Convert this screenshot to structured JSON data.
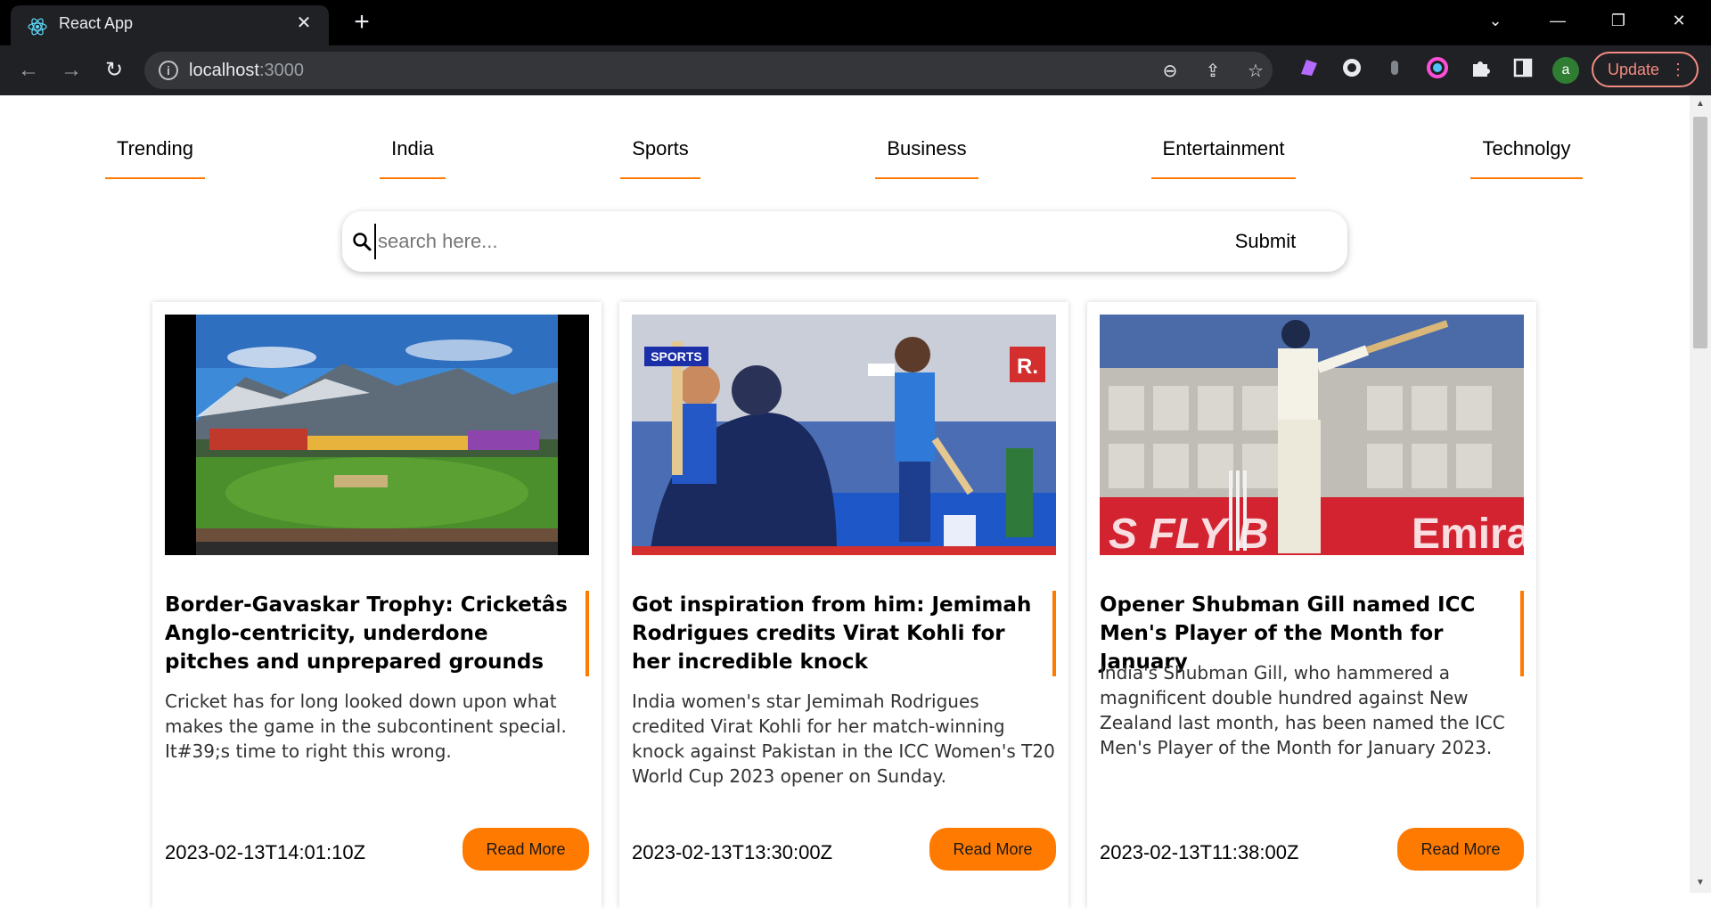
{
  "browser": {
    "tab_title": "React App",
    "url_host": "localhost",
    "url_port": ":3000",
    "profile_initial": "a",
    "update_label": "Update"
  },
  "nav": {
    "items": [
      "Trending",
      "India",
      "Sports",
      "Business",
      "Entertainment",
      "Technolgy"
    ]
  },
  "search": {
    "placeholder": "search here...",
    "submit_label": "Submit"
  },
  "cards": [
    {
      "title": "Border-Gavaskar Trophy: Cricketâs Anglo-centricity, underdone pitches and unprepared grounds",
      "description": "Cricket has for long looked down upon what makes the game in the subcontinent special. It#39;s time to right this wrong.",
      "date": "2023-02-13T14:01:10Z",
      "button": "Read More"
    },
    {
      "title": "Got inspiration from him: Jemimah Rodrigues credits Virat Kohli for her incredible knock",
      "description": "India women's star Jemimah Rodrigues credited Virat Kohli for her match-winning knock against Pakistan in the ICC Women's T20 World Cup 2023 opener on Sunday.",
      "date": "2023-02-13T13:30:00Z",
      "button": "Read More",
      "badge": "SPORTS",
      "logo": "R."
    },
    {
      "title": "Opener Shubman Gill named ICC Men's Player of the Month for January",
      "description": "India's Shubman Gill, who hammered a magnificent double hundred against New Zealand last month, has been named the ICC Men's Player of the Month for January 2023.",
      "date": "2023-02-13T11:38:00Z",
      "button": "Read More",
      "banner_text": "S FLY B",
      "banner_text2": "Emira"
    }
  ],
  "colors": {
    "accent": "#ff7a00"
  }
}
